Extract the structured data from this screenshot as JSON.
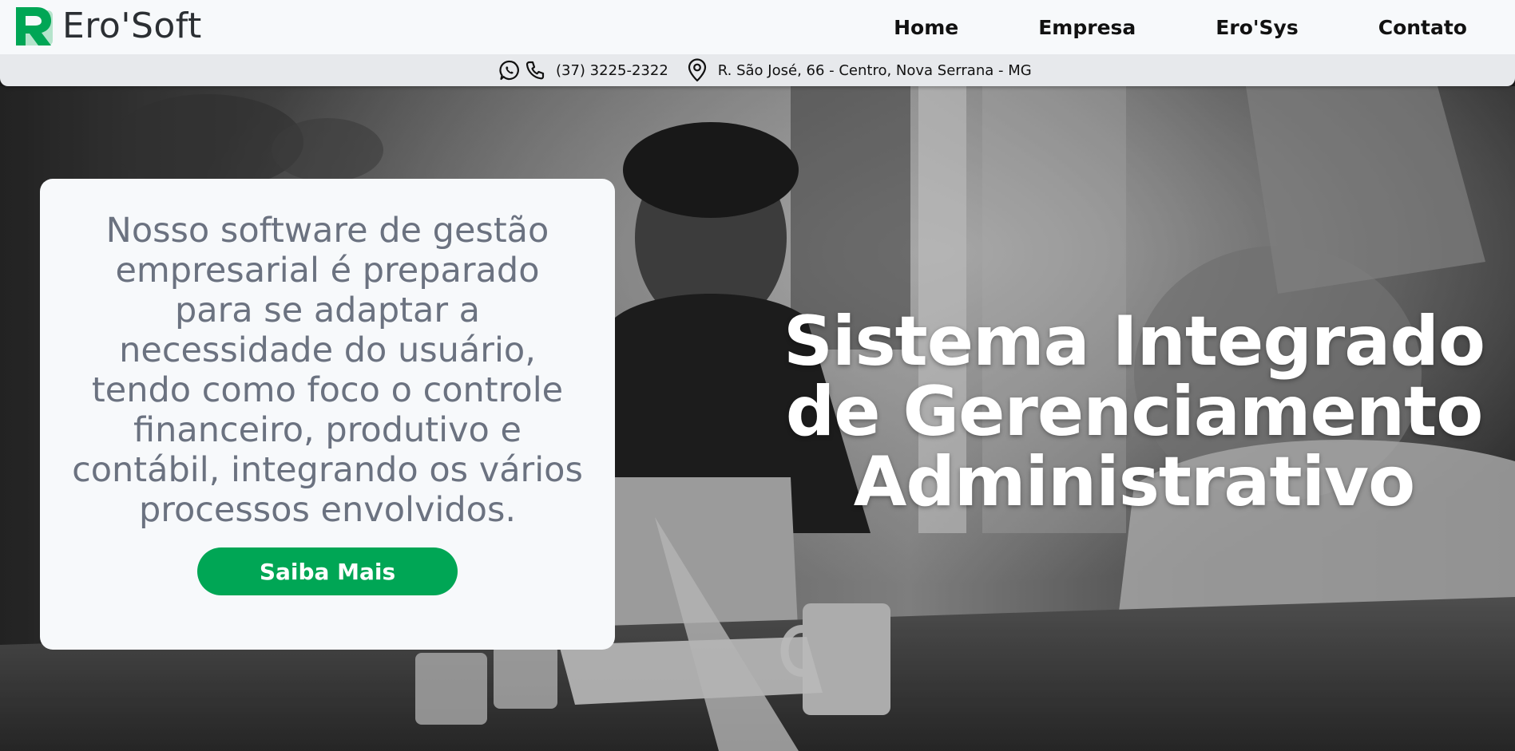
{
  "brand": {
    "name": "Ero'Soft",
    "logo_letter": "R",
    "accent_color": "#00a655"
  },
  "nav": {
    "items": [
      {
        "label": "Home"
      },
      {
        "label": "Empresa"
      },
      {
        "label": "Ero'Sys"
      },
      {
        "label": "Contato"
      }
    ]
  },
  "contact": {
    "icons": [
      "whatsapp-icon",
      "phone-icon",
      "location-pin-icon"
    ],
    "phone": "(37) 3225-2322",
    "address": "R. São José, 66 - Centro, Nova Serrana - MG"
  },
  "hero": {
    "card_text": "Nosso software de gestão empresarial é preparado para se adaptar a necessidade do usuário, tendo como foco o controle financeiro, produtivo e contábil, integrando os vários processos envolvidos.",
    "cta_label": "Saiba Mais",
    "title": "Sistema Integrado de Gerenciamento Administrativo",
    "background_description_tone": "grayscale"
  },
  "colors": {
    "nav_bg": "#f7f9fb",
    "contact_bg": "#e7e9ec",
    "card_text": "#6b7280",
    "cta_bg": "#00a655"
  }
}
